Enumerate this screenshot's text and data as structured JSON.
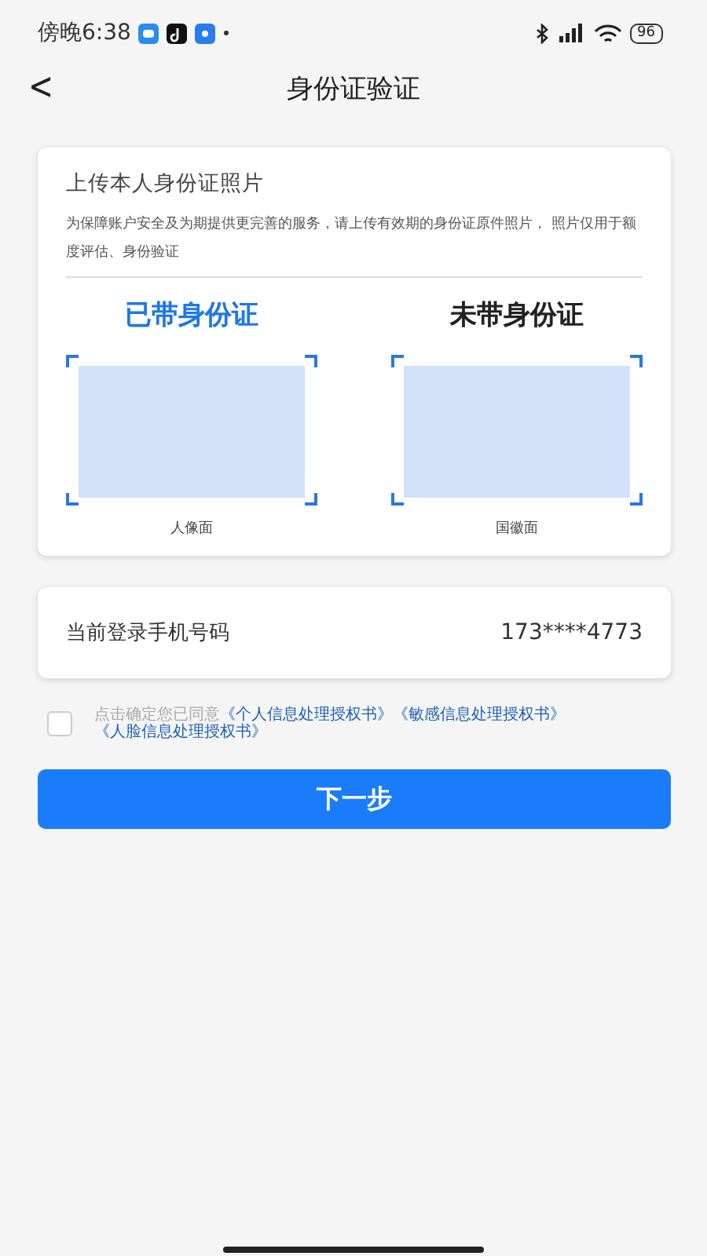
{
  "status_bar": {
    "time": "傍晚6:38",
    "battery": "96"
  },
  "header": {
    "back": "<",
    "title": "身份证验证"
  },
  "upload_card": {
    "title": "上传本人身份证照片",
    "description": "为保障账户安全及为期提供更完善的服务，请上传有效期的身份证原件照片， 照片仅用于额度评估、身份验证",
    "tabs": [
      {
        "label": "已带身份证",
        "selected": true
      },
      {
        "label": "未带身份证",
        "selected": false
      }
    ],
    "slots": [
      {
        "caption": "人像面"
      },
      {
        "caption": "国徽面"
      }
    ]
  },
  "phone_card": {
    "label": "当前登录手机号码",
    "value": "173****4773"
  },
  "agreement": {
    "checked": false,
    "text": "点击确定您已同意",
    "links": [
      "《个人信息处理授权书》",
      "《敏感信息处理授权书》",
      "《人脸信息处理授权书》"
    ]
  },
  "next_button": {
    "label": "下一步"
  }
}
